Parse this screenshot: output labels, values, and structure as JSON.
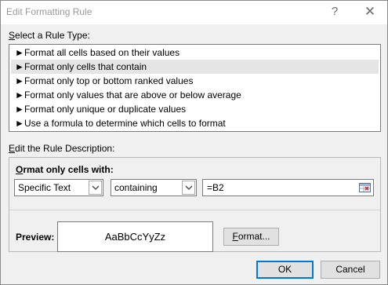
{
  "window": {
    "title": "Edit Formatting Rule",
    "help_glyph": "?",
    "close_glyph": "✕"
  },
  "rule_type": {
    "label": "Select a Rule Type:",
    "arrow_glyph": "►",
    "items": [
      {
        "label": "Format all cells based on their values"
      },
      {
        "label": "Format only cells that contain"
      },
      {
        "label": "Format only top or bottom ranked values"
      },
      {
        "label": "Format only values that are above or below average"
      },
      {
        "label": "Format only unique or duplicate values"
      },
      {
        "label": "Use a formula to determine which cells to format"
      }
    ],
    "selected_index": 1
  },
  "description": {
    "label": "Edit the Rule Description:",
    "format_only_label": "Format only cells with:",
    "combo1": {
      "value": "Specific Text"
    },
    "combo2": {
      "value": "containing"
    },
    "formula": {
      "value": "=B2"
    }
  },
  "preview": {
    "label": "Preview:",
    "sample_text": "AaBbCcYyZz",
    "format_button": "Format..."
  },
  "buttons": {
    "ok": "OK",
    "cancel": "Cancel"
  },
  "colors": {
    "selected_row": "#e5e5e5",
    "default_button_border": "#0078d7",
    "dialog_bg": "#f0f0f0"
  }
}
